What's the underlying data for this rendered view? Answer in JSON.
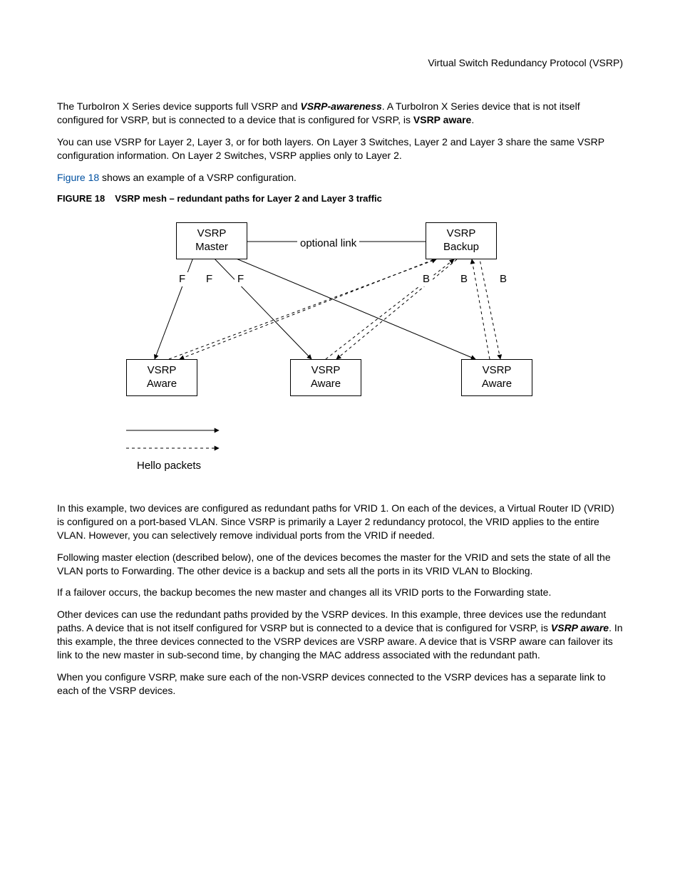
{
  "header": {
    "section": "Virtual Switch Redundancy Protocol (VSRP)"
  },
  "p1": {
    "a": "The TurboIron X Series device supports full VSRP and ",
    "b": "VSRP-awareness",
    "c": ". A TurboIron X Series device that is not itself configured for VSRP, but is connected to a device that is configured for VSRP, is ",
    "d": "VSRP aware",
    "e": "."
  },
  "p2": "You can use VSRP for Layer 2, Layer 3, or for both layers.  On Layer 3 Switches, Layer 2 and Layer 3 share the same VSRP configuration information.  On Layer 2 Switches, VSRP applies only to Layer 2.",
  "p3": {
    "link": "Figure 18",
    "rest": " shows an example of a VSRP configuration."
  },
  "fig": {
    "num": "FIGURE 18",
    "cap": "VSRP mesh – redundant paths for Layer 2 and Layer 3 traffic"
  },
  "diagram": {
    "master": {
      "l1": "VSRP",
      "l2": "Master"
    },
    "backup": {
      "l1": "VSRP",
      "l2": "Backup"
    },
    "aware": {
      "l1": "VSRP",
      "l2": "Aware"
    },
    "optlink": "optional link",
    "F": "F",
    "B": "B",
    "legend": "Hello packets"
  },
  "p4": "In this example, two devices are configured as redundant paths for VRID 1.  On each of the devices, a Virtual Router ID (VRID) is configured on a port-based VLAN.  Since VSRP is primarily a Layer 2 redundancy protocol, the VRID applies to the entire VLAN.  However, you can selectively remove individual ports from the VRID if needed.",
  "p5": "Following master election (described below), one of the devices becomes the master for the VRID and sets the state of all the VLAN ports to Forwarding.  The other device is a backup and sets all the ports in its VRID VLAN to Blocking.",
  "p6": "If a failover occurs, the backup becomes the new master and changes all its VRID ports to the Forwarding state.",
  "p7": {
    "a": "Other devices can use the redundant paths provided by the VSRP devices.  In this example, three devices use the redundant paths.  A device that is not itself configured for VSRP but is connected to a device that is configured for VSRP, is ",
    "b": "VSRP aware",
    "c": ".  In this example, the three devices connected to the VSRP devices are VSRP aware.  A device that is VSRP aware can failover its link to the new master in sub-second time, by changing the MAC address associated with the redundant path."
  },
  "p8": "When you configure VSRP, make sure each of the non-VSRP devices connected to the VSRP devices has a separate link to each of the VSRP devices."
}
